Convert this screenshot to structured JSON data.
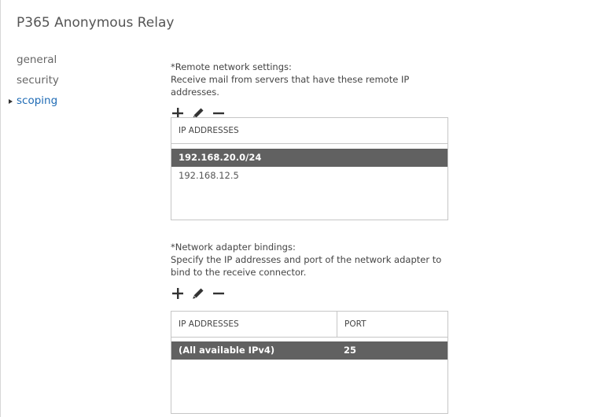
{
  "title": "P365 Anonymous Relay",
  "nav": {
    "items": [
      {
        "label": "general",
        "active": false
      },
      {
        "label": "security",
        "active": false
      },
      {
        "label": "scoping",
        "active": true
      }
    ]
  },
  "remote": {
    "heading": "*Remote network settings:",
    "description": "Receive mail from servers that have these remote IP addresses.",
    "columns": [
      "IP ADDRESSES"
    ],
    "rows": [
      {
        "ip": "192.168.20.0/24",
        "selected": true
      },
      {
        "ip": "192.168.12.5",
        "selected": false
      }
    ]
  },
  "bindings": {
    "heading": "*Network adapter bindings:",
    "description_line1": "Specify the IP addresses and port of the network adapter to",
    "description_line2": "bind to the receive connector.",
    "columns": [
      "IP ADDRESSES",
      "PORT"
    ],
    "rows": [
      {
        "ip": "(All available IPv4)",
        "port": "25",
        "selected": true
      }
    ]
  },
  "icons": {
    "add": "plus-icon",
    "edit": "pencil-icon",
    "remove": "minus-icon"
  },
  "colors": {
    "selected_row": "#616161",
    "nav_active": "#1f6bb5"
  }
}
